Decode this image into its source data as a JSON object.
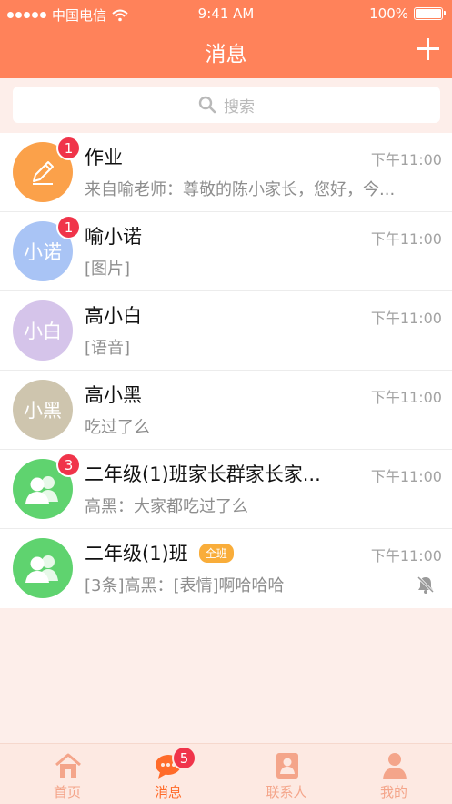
{
  "status_bar": {
    "carrier": "中国电信",
    "time": "9:41 AM",
    "battery": "100%"
  },
  "nav": {
    "title": "消息"
  },
  "search": {
    "placeholder": "搜索"
  },
  "messages": [
    {
      "name": "作业",
      "time": "下午11:00",
      "preview": "来自喻老师：尊敬的陈小家长，您好，今...",
      "avatar_text": "",
      "avatar_icon": "pencil-icon",
      "avatar_color": "#fba14a",
      "badge": "1"
    },
    {
      "name": "喻小诺",
      "time": "下午11:00",
      "preview": "[图片]",
      "avatar_text": "小诺",
      "avatar_color": "#a9c4f5",
      "badge": "1"
    },
    {
      "name": "高小白",
      "time": "下午11:00",
      "preview": "[语音]",
      "avatar_text": "小白",
      "avatar_color": "#d5c4ea",
      "badge": ""
    },
    {
      "name": "高小黑",
      "time": "下午11:00",
      "preview": "吃过了么",
      "avatar_text": "小黑",
      "avatar_color": "#cec5ae",
      "badge": ""
    },
    {
      "name": "二年级(1)班家长群家长家...",
      "time": "下午11:00",
      "preview": "高黑：大家都吃过了么",
      "avatar_text": "",
      "avatar_icon": "group-icon",
      "avatar_color": "#5fd36f",
      "badge": "3"
    },
    {
      "name": "二年级(1)班",
      "tag": "全班",
      "time": "下午11:00",
      "preview": "[3条]高黑：[表情]啊哈哈哈",
      "avatar_text": "",
      "avatar_icon": "group-icon",
      "avatar_color": "#5fd36f",
      "badge": "",
      "muted": true
    }
  ],
  "tabs": [
    {
      "label": "首页",
      "icon": "home-icon"
    },
    {
      "label": "消息",
      "icon": "chat-icon",
      "badge": "5",
      "active": true
    },
    {
      "label": "联系人",
      "icon": "contacts-icon"
    },
    {
      "label": "我的",
      "icon": "person-icon"
    }
  ],
  "colors": {
    "primary": "#ff825a",
    "badge": "#f0344a",
    "tab_inactive": "#f4a58a",
    "tab_active": "#ff6b2a",
    "tag": "#f9ad3a"
  }
}
